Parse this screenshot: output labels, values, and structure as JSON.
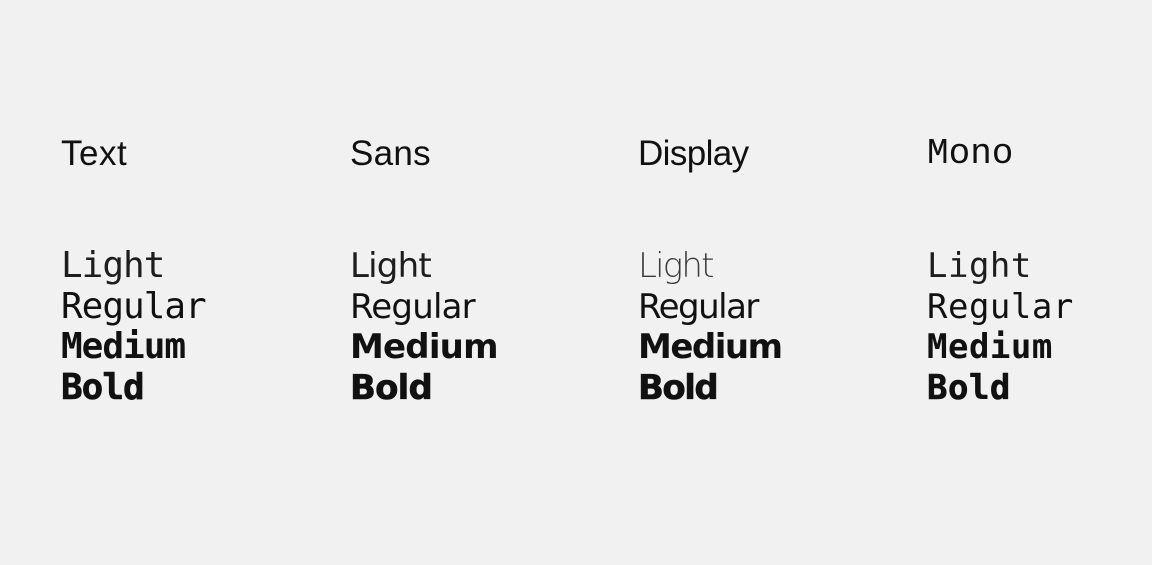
{
  "families": [
    {
      "name": "Text",
      "weights": {
        "light": "Light",
        "regular": "Regular",
        "medium": "Medium",
        "bold": "Bold"
      }
    },
    {
      "name": "Sans",
      "weights": {
        "light": "Light",
        "regular": "Regular",
        "medium": "Medium",
        "bold": "Bold"
      }
    },
    {
      "name": "Display",
      "weights": {
        "light": "Light",
        "regular": "Regular",
        "medium": "Medium",
        "bold": "Bold"
      }
    },
    {
      "name": "Mono",
      "weights": {
        "light": "Light",
        "regular": "Regular",
        "medium": "Medium",
        "bold": "Bold"
      }
    }
  ],
  "colors": {
    "background": "#f1f1f1",
    "text": "#111111"
  }
}
